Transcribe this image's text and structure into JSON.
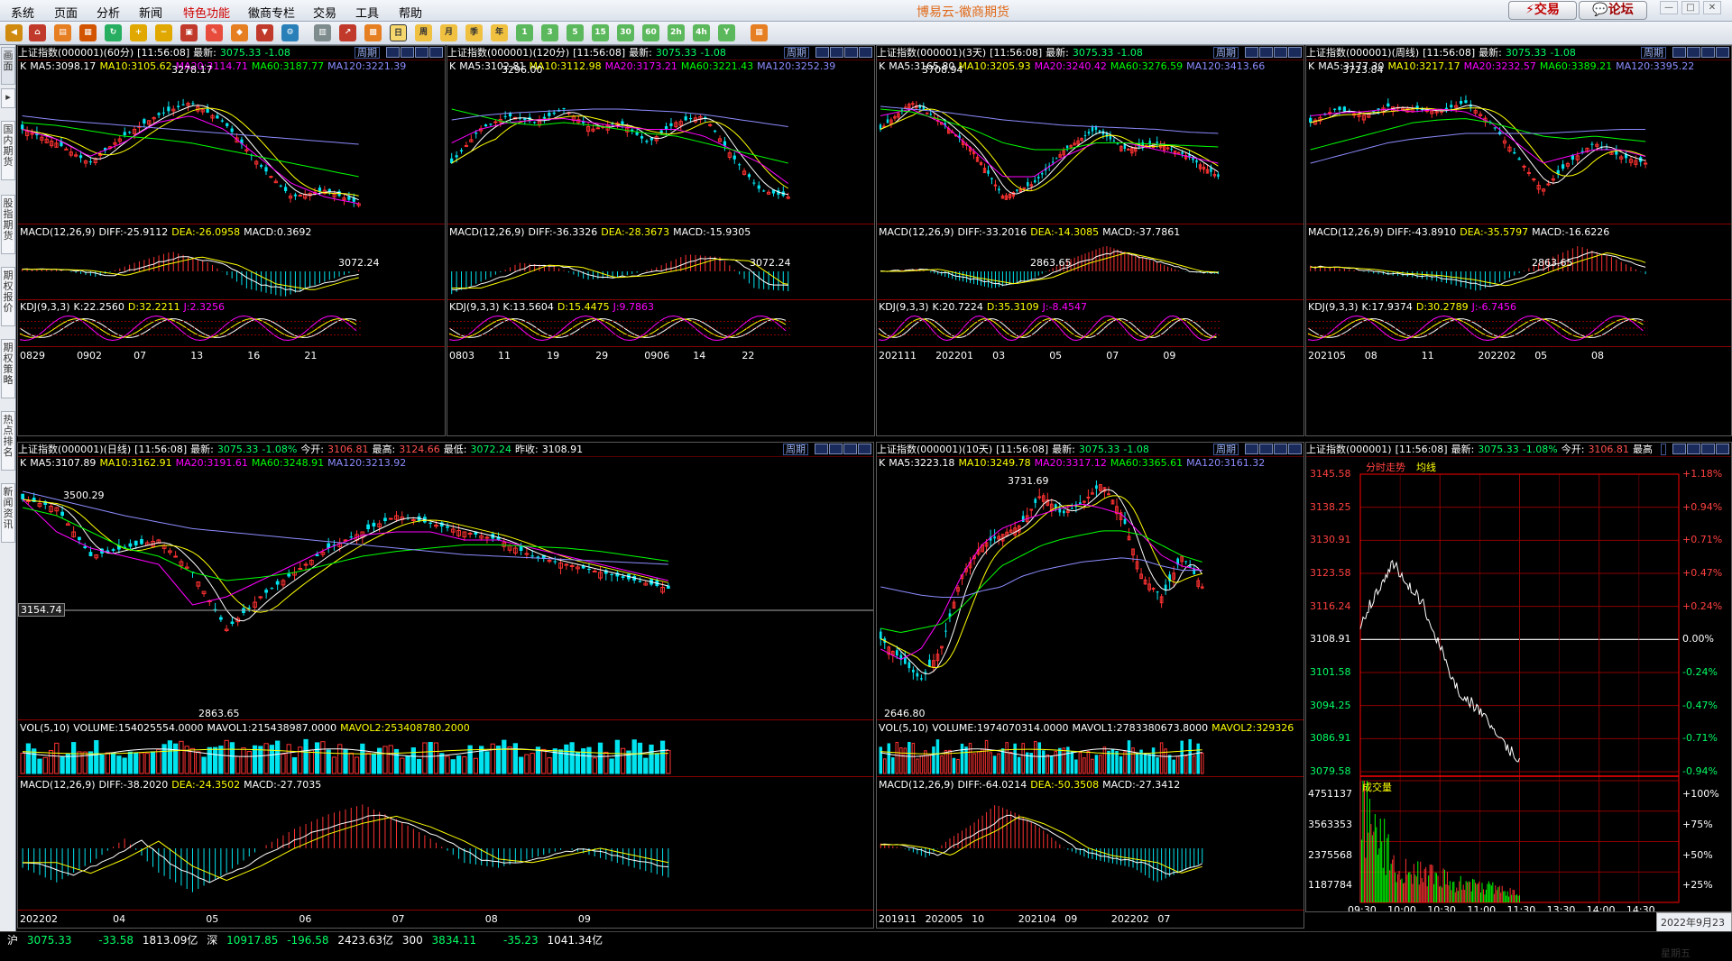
{
  "menu": {
    "items": [
      "系统",
      "页面",
      "分析",
      "新闻",
      "特色功能",
      "徽商专栏",
      "交易",
      "工具",
      "帮助"
    ]
  },
  "app": {
    "title": "博易云-徽商期货",
    "trade_btn": "交易",
    "forum_btn": "论坛"
  },
  "toolbar": {
    "labels": [
      "周",
      "月",
      "季",
      "年",
      "1",
      "3",
      "5",
      "15",
      "30",
      "60",
      "2h",
      "4h",
      "Y"
    ]
  },
  "sidebar": {
    "tabs": [
      "新闻资讯",
      "热点排名",
      "期权策略",
      "期权报价",
      "股指期货",
      "国内期货",
      "报价"
    ]
  },
  "colors": {
    "up": "#ff3232",
    "down": "#00e4f0",
    "ma5": "#ffffff",
    "ma10": "#ffff00",
    "ma20": "#ff00ff",
    "ma60": "#00ff00",
    "ma120": "#8c8cff"
  },
  "panels": {
    "p60": {
      "title": "上证指数(000001)(60分)",
      "time": "[11:56:08]",
      "last_label": "最新:",
      "last": "3075.33",
      "chg": "-1.08",
      "period": "周期",
      "ma5": "MA5:3098.17",
      "ma10": "MA10:3105.62",
      "ma20": "MA20:3114.71",
      "ma60": "MA60:3187.77",
      "ma120": "MA120:3221.39",
      "high": "3278.17",
      "low": "3072.24",
      "macd": {
        "name": "MACD(12,26,9)",
        "diff": "DIFF:-25.9112",
        "dea": "DEA:-26.0958",
        "macd": "MACD:0.3692"
      },
      "kdj": {
        "name": "KDJ(9,3,3)",
        "k": "K:22.2560",
        "d": "D:32.2211",
        "j": "J:2.3256"
      },
      "x": [
        "0829",
        "0902",
        "07",
        "13",
        "16",
        "21"
      ]
    },
    "p120": {
      "title": "上证指数(000001)(120分)",
      "time": "[11:56:08]",
      "last_label": "最新:",
      "last": "3075.33",
      "chg": "-1.08",
      "period": "周期",
      "ma5": "MA5:3102.81",
      "ma10": "MA10:3112.98",
      "ma20": "MA20:3173.21",
      "ma60": "MA60:3221.43",
      "ma120": "MA120:3252.39",
      "high": "3296.00",
      "low": "3072.24",
      "macd": {
        "name": "MACD(12,26,9)",
        "diff": "DIFF:-36.3326",
        "dea": "DEA:-28.3673",
        "macd": "MACD:-15.9305"
      },
      "kdj": {
        "name": "KDJ(9,3,3)",
        "k": "K:13.5604",
        "d": "D:15.4475",
        "j": "J:9.7863"
      },
      "x": [
        "0803",
        "11",
        "19",
        "29",
        "0906",
        "14",
        "22"
      ]
    },
    "p3d": {
      "title": "上证指数(000001)(3天)",
      "time": "[11:56:08]",
      "last_label": "最新:",
      "last": "3075.33",
      "chg": "-1.08",
      "period": "周期",
      "ma5": "MA5:3165.80",
      "ma10": "MA10:3205.93",
      "ma20": "MA20:3240.42",
      "ma60": "MA60:3276.59",
      "ma120": "MA120:3413.66",
      "high": "3708.94",
      "low": "2863.65",
      "macd": {
        "name": "MACD(12,26,9)",
        "diff": "DIFF:-33.2016",
        "dea": "DEA:-14.3085",
        "macd": "MACD:-37.7861"
      },
      "kdj": {
        "name": "KDJ(9,3,3)",
        "k": "K:20.7224",
        "d": "D:35.3109",
        "j": "J:-8.4547"
      },
      "x": [
        "202111",
        "202201",
        "03",
        "05",
        "07",
        "09"
      ]
    },
    "pwk": {
      "title": "上证指数(000001)(周线)",
      "time": "[11:56:08]",
      "last_label": "最新:",
      "last": "3075.33",
      "chg": "-1.08",
      "period": "周期",
      "ma5": "MA5:3177.30",
      "ma10": "MA10:3217.17",
      "ma20": "MA20:3232.57",
      "ma60": "MA60:3389.21",
      "ma120": "MA120:3395.22",
      "high": "3723.84",
      "low": "2863.65",
      "macd": {
        "name": "MACD(12,26,9)",
        "diff": "DIFF:-43.8910",
        "dea": "DEA:-35.5797",
        "macd": "MACD:-16.6226"
      },
      "kdj": {
        "name": "KDJ(9,3,3)",
        "k": "K:17.9374",
        "d": "D:30.2789",
        "j": "J:-6.7456"
      },
      "x": [
        "202105",
        "08",
        "11",
        "202202",
        "05",
        "08"
      ]
    },
    "pday": {
      "title": "上证指数(000001)(日线)",
      "time": "[11:56:08]",
      "last_label": "最新:",
      "last": "3075.33",
      "chg": "-1.08%",
      "open_label": "今开:",
      "open": "3106.81",
      "high_label": "最高:",
      "hi": "3124.66",
      "low_label": "最低:",
      "lo": "3072.24",
      "prev_label": "昨收:",
      "prev": "3108.91",
      "period": "周期",
      "ma5": "MA5:3107.89",
      "ma10": "MA10:3162.91",
      "ma20": "MA20:3191.61",
      "ma60": "MA60:3248.91",
      "ma120": "MA120:3213.92",
      "high": "3500.29",
      "low": "2863.65",
      "cursor": "3154.74",
      "vol": {
        "name": "VOL(5,10)",
        "volume": "VOLUME:154025554.0000",
        "mavol1": "MAVOL1:215438987.0000",
        "mavol2": "MAVOL2:253408780.2000"
      },
      "macd": {
        "name": "MACD(12,26,9)",
        "diff": "DIFF:-38.2020",
        "dea": "DEA:-24.3502",
        "macd": "MACD:-27.7035"
      },
      "x": [
        "202202",
        "04",
        "05",
        "06",
        "07",
        "08",
        "09"
      ]
    },
    "p10d": {
      "title": "上证指数(000001)(10天)",
      "time": "[11:56:08]",
      "last_label": "最新:",
      "last": "3075.33",
      "chg": "-1.08",
      "period": "周期",
      "ma5": "MA5:3223.18",
      "ma10": "MA10:3249.78",
      "ma20": "MA20:3317.12",
      "ma60": "MA60:3365.61",
      "ma120": "MA120:3161.32",
      "high": "3731.69",
      "low": "2646.80",
      "vol": {
        "name": "VOL(5,10)",
        "volume": "VOLUME:1974070314.0000",
        "mavol1": "MAVOL1:2783380673.8000",
        "mavol2": "MAVOL2:329326"
      },
      "macd": {
        "name": "MACD(12,26,9)",
        "diff": "DIFF:-64.0214",
        "dea": "DEA:-50.3508",
        "macd": "MACD:-27.3412"
      },
      "x": [
        "201911",
        "202005",
        "10",
        "202104",
        "09",
        "202202",
        "07"
      ]
    },
    "ptime": {
      "title": "上证指数(000001)",
      "time": "[11:56:08]",
      "last_label": "最新:",
      "last": "3075.33",
      "chg": "-1.08%",
      "open_label": "今开:",
      "open": "3106.81",
      "high_label": "最高",
      "trend": "分时走势",
      "avg": "均线",
      "vol_label": "成交量",
      "prices": [
        "3145.58",
        "3138.25",
        "3130.91",
        "3123.58",
        "3116.24",
        "3108.91",
        "3101.58",
        "3094.25",
        "3086.91",
        "3079.58"
      ],
      "pcts": [
        "+1.18%",
        "+0.94%",
        "+0.71%",
        "+0.47%",
        "+0.24%",
        "0.00%",
        "-0.24%",
        "-0.47%",
        "-0.71%",
        "-0.94%"
      ],
      "vols": [
        "4751137",
        "3563353",
        "2375568",
        "1187784"
      ],
      "vpcts": [
        "+100%",
        "+75%",
        "+50%",
        "+25%"
      ],
      "x": [
        "09:30",
        "10:00",
        "10:30",
        "11:00",
        "11:30",
        "13:30",
        "14:00",
        "14:30"
      ]
    }
  },
  "chart_data": [
    {
      "type": "line",
      "title": "分时走势",
      "x": [
        "09:30",
        "10:00",
        "10:30",
        "11:00",
        "11:30"
      ],
      "values": [
        3108.91,
        3124.0,
        3113.0,
        3093.0,
        3085.0,
        3074.5
      ],
      "ylim": [
        3072.24,
        3145.58
      ]
    },
    {
      "type": "bar",
      "title": "成交量",
      "x": [
        "09:30",
        "10:00",
        "10:30",
        "11:00",
        "11:30"
      ],
      "values": [
        4751137,
        1800000,
        1250000,
        950000,
        700000,
        380000
      ],
      "ylim": [
        0,
        4751137
      ]
    }
  ],
  "status": {
    "sh_label": "沪",
    "sh": "3075.33",
    "sh_chg": "-33.58",
    "sh_amt": "1813.09亿",
    "sz_label": "深",
    "sz": "10917.85",
    "sz_chg": "-196.58",
    "sz_amt": "2423.63亿",
    "i300_label": "300",
    "i300": "3834.11",
    "i300_chg": "-35.23",
    "i300_amt": "1041.34亿"
  },
  "datebox": {
    "date": "2022年9月23日",
    "weekday": "星期五"
  }
}
